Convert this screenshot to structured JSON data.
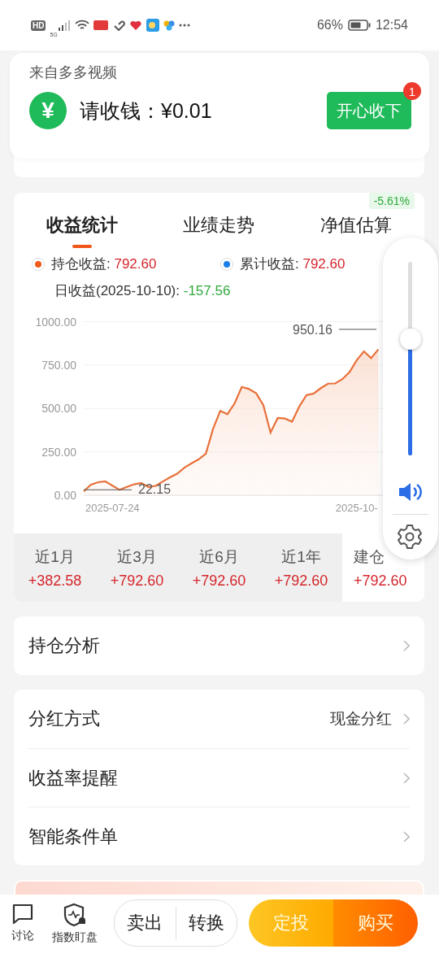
{
  "status_bar": {
    "network_badge": "HD",
    "network_type": "5G",
    "battery": "66%",
    "time": "12:54"
  },
  "notification": {
    "source": "来自多多视频",
    "icon": "¥",
    "message": "请收钱：¥0.01",
    "button": "开心收下",
    "badge": "1"
  },
  "fund_panel": {
    "tabs": [
      {
        "label": "收益统计",
        "selected": true
      },
      {
        "label": "业绩走势",
        "selected": false
      },
      {
        "label": "净值估算",
        "selected": false,
        "badge": "-5.61%"
      }
    ],
    "legend": [
      {
        "label": "持仓收益:",
        "value": "792.60",
        "color": "#f05a1a"
      },
      {
        "label": "累计收益:",
        "value": "792.60",
        "color": "#1a7fe8"
      }
    ],
    "daily": {
      "label": "日收益(2025-10-10):",
      "value": "-157.56"
    },
    "chart_data": {
      "type": "area",
      "categories": [
        null,
        null,
        null,
        null,
        "2025-07-24",
        null,
        null,
        null,
        null,
        null,
        null,
        null,
        null,
        null,
        null,
        null,
        null,
        null,
        null,
        null,
        null,
        null,
        null,
        null,
        null,
        null,
        null,
        null,
        null,
        null,
        null,
        null,
        null,
        null,
        null,
        null,
        null,
        null,
        "2025-10-",
        null,
        null,
        null,
        null,
        null
      ],
      "grid": true,
      "series": [
        {
          "color": "#e8703a",
          "values": [
            22,
            61,
            75,
            80,
            55,
            31,
            48,
            63,
            71,
            48,
            54,
            79,
            103,
            124,
            159,
            184,
            207,
            240,
            382,
            486,
            467,
            529,
            624,
            612,
            587,
            519,
            361,
            445,
            442,
            424,
            511,
            576,
            586,
            617,
            643,
            644,
            669,
            709,
            778,
            829,
            790,
            840,
            null,
            null
          ]
        }
      ],
      "ylim": [
        0,
        1000
      ],
      "yticks": [
        {
          "value": 0,
          "label": "0.00"
        },
        {
          "value": 250,
          "label": "250.00"
        },
        {
          "value": 500,
          "label": "500.00"
        },
        {
          "value": 750,
          "label": "750.00"
        },
        {
          "value": 1000,
          "label": "1000.00"
        }
      ],
      "annotations": [
        {
          "y": 22.15,
          "text": "22.15"
        },
        "950.16"
      ]
    },
    "periods": [
      {
        "label": "近1月",
        "value": "+382.58",
        "selected": false
      },
      {
        "label": "近3月",
        "value": "+792.60",
        "selected": false
      },
      {
        "label": "近6月",
        "value": "+792.60",
        "selected": false
      },
      {
        "label": "近1年",
        "value": "+792.60",
        "selected": false
      },
      {
        "label": "建仓",
        "value": "+792.60",
        "selected": true
      }
    ]
  },
  "volume_panel": {
    "level": 0.6
  },
  "holdings": {
    "label": "持仓分析"
  },
  "settings": [
    {
      "label": "分红方式",
      "value": "现金分红"
    },
    {
      "label": "收益率提醒"
    },
    {
      "label": "智能条件单"
    }
  ],
  "bottom_bar": {
    "links": [
      {
        "label": "讨论",
        "kind": "chat"
      },
      {
        "label": "指数盯盘",
        "kind": "monitor"
      }
    ],
    "trade": [
      "卖出",
      "转换"
    ],
    "actions": [
      "定投",
      "购买"
    ]
  }
}
